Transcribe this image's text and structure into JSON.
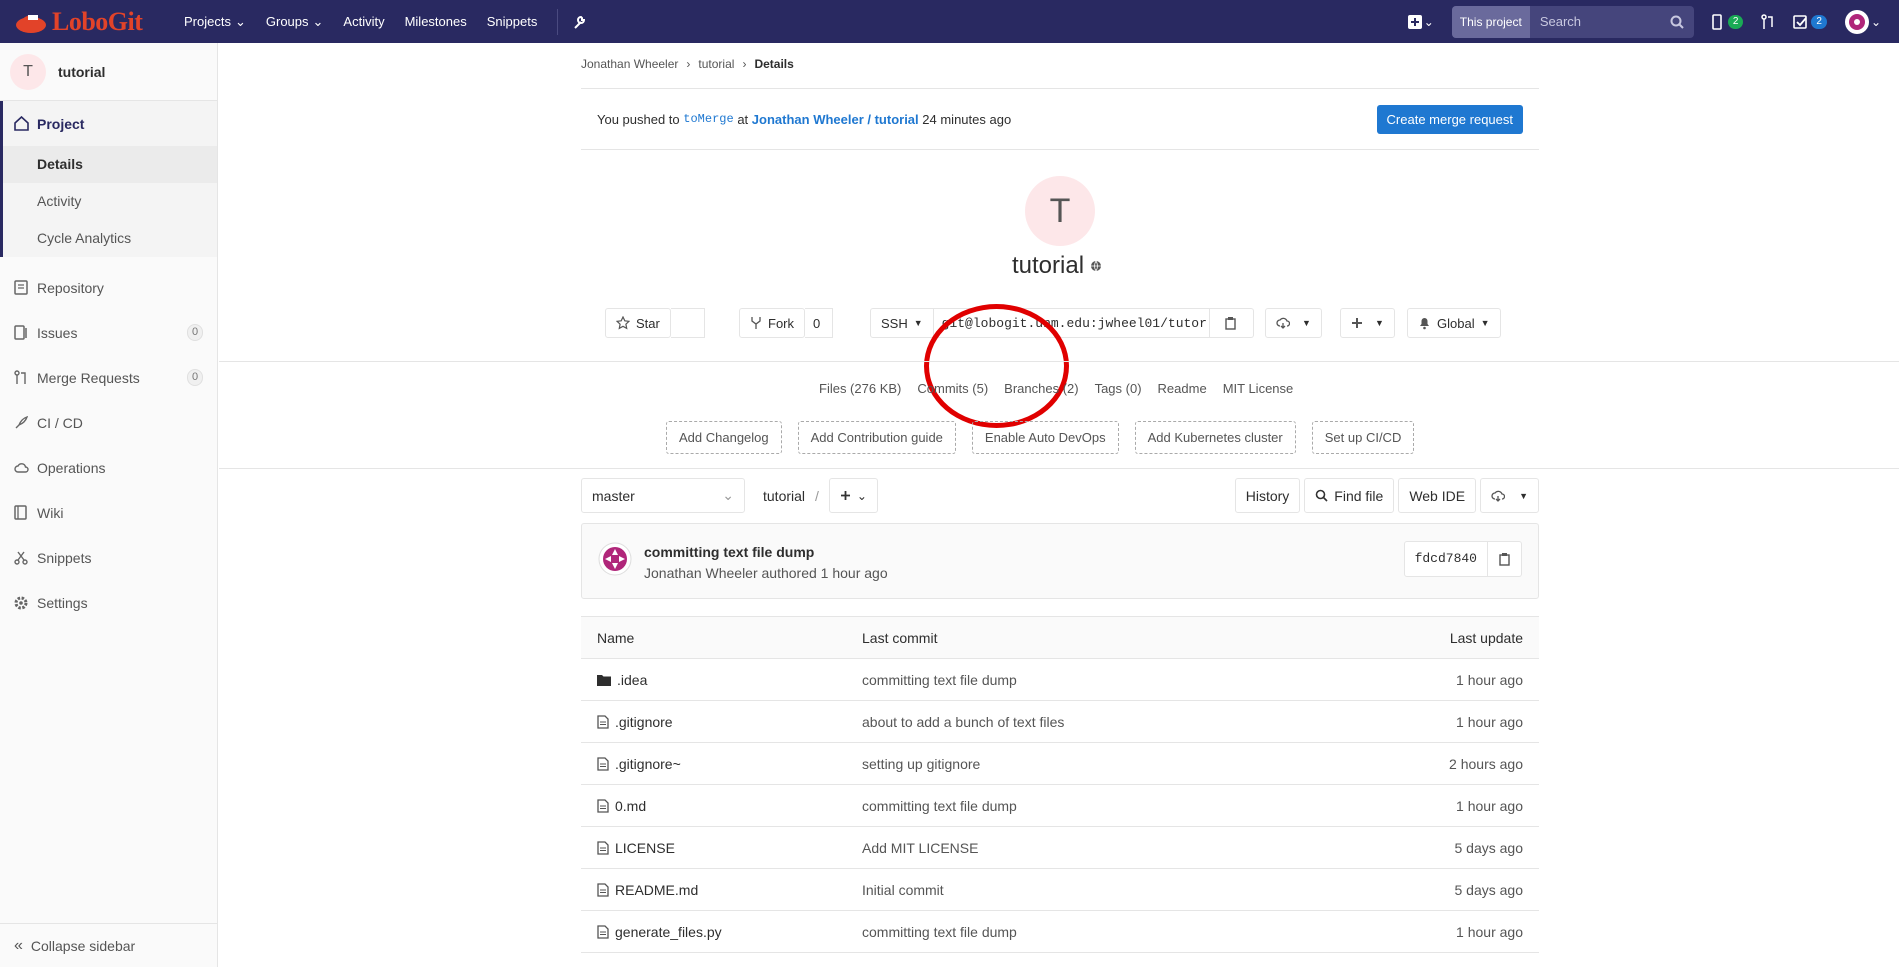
{
  "topnav": {
    "logo": "LoboGit",
    "links": [
      "Projects",
      "Groups",
      "Activity",
      "Milestones",
      "Snippets"
    ],
    "search_scope": "This project",
    "search_placeholder": "Search",
    "issues_count": "2",
    "todos_count": "2"
  },
  "sidebar": {
    "project_initial": "T",
    "project_name": "tutorial",
    "project_label": "Project",
    "subitems": [
      "Details",
      "Activity",
      "Cycle Analytics"
    ],
    "items": [
      {
        "label": "Repository"
      },
      {
        "label": "Issues",
        "count": "0"
      },
      {
        "label": "Merge Requests",
        "count": "0"
      },
      {
        "label": "CI / CD"
      },
      {
        "label": "Operations"
      },
      {
        "label": "Wiki"
      },
      {
        "label": "Snippets"
      },
      {
        "label": "Settings"
      }
    ],
    "collapse": "Collapse sidebar"
  },
  "breadcrumb": [
    "Jonathan Wheeler",
    "tutorial",
    "Details"
  ],
  "push": {
    "prefix": "You pushed to",
    "branch": "toMerge",
    "at": "at",
    "project": "Jonathan Wheeler / tutorial",
    "time": "24 minutes ago",
    "button": "Create merge request"
  },
  "project": {
    "initial": "T",
    "name": "tutorial",
    "star": "Star",
    "star_count": "",
    "fork": "Fork",
    "fork_count": "0",
    "protocol": "SSH",
    "clone_url": "git@lobogit.unm.edu:jwheel01/tutor",
    "notification": "Global"
  },
  "stats": [
    "Files (276 KB)",
    "Commits (5)",
    "Branches (2)",
    "Tags (0)",
    "Readme",
    "MIT License"
  ],
  "add_buttons": [
    "Add Changelog",
    "Add Contribution guide",
    "Enable Auto DevOps",
    "Add Kubernetes cluster",
    "Set up CI/CD"
  ],
  "tree": {
    "branch": "master",
    "path": "tutorial",
    "sep": "/",
    "history": "History",
    "find_file": "Find file",
    "web_ide": "Web IDE"
  },
  "last_commit": {
    "message": "committing text file dump",
    "author": "Jonathan Wheeler authored 1 hour ago",
    "sha": "fdcd7840"
  },
  "table": {
    "headers": [
      "Name",
      "Last commit",
      "Last update"
    ],
    "rows": [
      {
        "type": "folder",
        "name": ".idea",
        "commit": "committing text file dump",
        "updated": "1 hour ago"
      },
      {
        "type": "file",
        "name": ".gitignore",
        "commit": "about to add a bunch of text files",
        "updated": "1 hour ago"
      },
      {
        "type": "file",
        "name": ".gitignore~",
        "commit": "setting up gitignore",
        "updated": "2 hours ago"
      },
      {
        "type": "file",
        "name": "0.md",
        "commit": "committing text file dump",
        "updated": "1 hour ago"
      },
      {
        "type": "file",
        "name": "LICENSE",
        "commit": "Add MIT LICENSE",
        "updated": "5 days ago"
      },
      {
        "type": "file",
        "name": "README.md",
        "commit": "Initial commit",
        "updated": "5 days ago"
      },
      {
        "type": "file",
        "name": "generate_files.py",
        "commit": "committing text file dump",
        "updated": "1 hour ago"
      }
    ]
  },
  "colors": {
    "nav": "#292961",
    "accent": "#1f78d1",
    "annotation": "#e00000"
  }
}
